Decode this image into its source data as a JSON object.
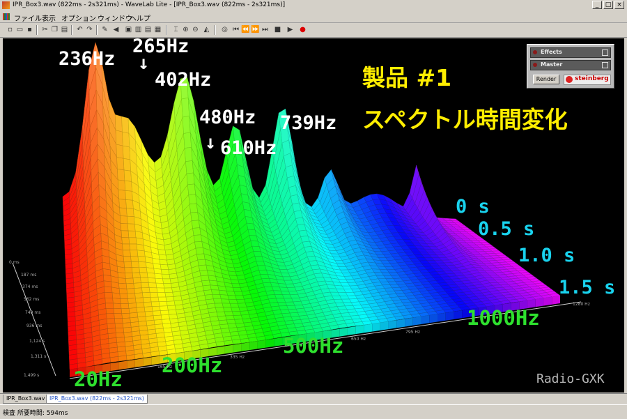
{
  "window": {
    "title": "IPR_Box3.wav (822ms - 2s321ms) - WaveLab Lite - [IPR_Box3.wav (822ms - 2s321ms)]",
    "minimize": "_",
    "maximize": "□",
    "close": "×"
  },
  "menu": {
    "items": [
      "ファイル",
      "表示",
      "オプション",
      "ウィンドウ",
      "ヘルプ"
    ]
  },
  "toolbar": {
    "icons": [
      "new-icon",
      "open-icon",
      "save-icon",
      "cut-icon",
      "copy-icon",
      "paste-icon",
      "undo-icon",
      "redo-icon",
      "pencil-icon",
      "speaker-icon",
      "view1-icon",
      "view2-icon",
      "view3-icon",
      "view4-icon",
      "cursor-icon",
      "zoom-in-icon",
      "zoom-out-icon",
      "fade-icon",
      "cd-icon",
      "to-start-icon",
      "rewind-icon",
      "forward-icon",
      "to-end-icon",
      "stop-icon",
      "play-icon",
      "record-icon"
    ]
  },
  "overlay": {
    "title_line1": "製品 #1",
    "title_line2": "スペクトル時間変化",
    "freq_labels": [
      "236Hz",
      "265Hz",
      "402Hz",
      "480Hz",
      "610Hz",
      "739Hz"
    ],
    "arrow": "↓",
    "time_labels": [
      "0 s",
      "0.5 s",
      "1.0 s",
      "1.5 s"
    ],
    "x_axis_labels": [
      "20Hz",
      "200Hz",
      "500Hz",
      "1000Hz"
    ],
    "brand": "Radio-GXK"
  },
  "axis_ticks": {
    "time": [
      "0 ms",
      "187 ms",
      "374 ms",
      "562 ms",
      "749 ms",
      "936 ms",
      "1,124 s",
      "1,311 s",
      "1,499 s"
    ],
    "freq": [
      "165 Hz",
      "335 Hz",
      "650 Hz",
      "795 Hz",
      "1280 Hz"
    ]
  },
  "effects_panel": {
    "effects": "Effects",
    "master": "Master",
    "render": "Render",
    "brand": "steinberg"
  },
  "tabs": [
    "IPR_Box3.wav",
    "IPR_Box3.wav (822ms - 2s321ms)"
  ],
  "status": {
    "text": "検査 所要時間: 594ms"
  },
  "chart_data": {
    "type": "area",
    "title": "製品 #1 スペクトル時間変化",
    "xlabel": "",
    "ylabel": "",
    "x_labels": [
      "20Hz",
      "200Hz",
      "500Hz",
      "1000Hz"
    ],
    "z_labels": [
      "0 s",
      "0.5 s",
      "1.0 s",
      "1.5 s"
    ],
    "peaks_hz": [
      236,
      265,
      402,
      480,
      610,
      739
    ]
  }
}
